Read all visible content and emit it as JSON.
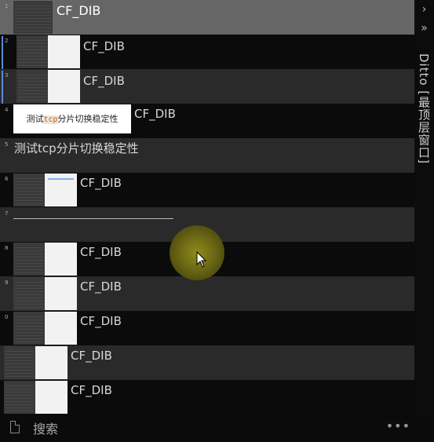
{
  "app": {
    "title": "Ditto [最顶层窗口]"
  },
  "sidebar": {
    "chevron_top": "›",
    "chevron_double": "»"
  },
  "rows": [
    {
      "num": "1",
      "label": "CF_DIB",
      "kind": "image"
    },
    {
      "num": "2",
      "label": "CF_DIB",
      "kind": "image"
    },
    {
      "num": "3",
      "label": "CF_DIB",
      "kind": "image"
    },
    {
      "num": "4",
      "label": "CF_DIB",
      "kind": "text-image",
      "card_prefix": "测试",
      "card_code": "tcp",
      "card_suffix": "分片切换稳定性"
    },
    {
      "num": "5",
      "label": "测试tcp分片切换稳定性",
      "kind": "text"
    },
    {
      "num": "6",
      "label": "CF_DIB",
      "kind": "image"
    },
    {
      "num": "7",
      "label": "",
      "kind": "line"
    },
    {
      "num": "8",
      "label": "CF_DIB",
      "kind": "image"
    },
    {
      "num": "9",
      "label": "CF_DIB",
      "kind": "image"
    },
    {
      "num": "0",
      "label": "CF_DIB",
      "kind": "image"
    },
    {
      "num": "",
      "label": "CF_DIB",
      "kind": "image"
    },
    {
      "num": "",
      "label": "CF_DIB",
      "kind": "image"
    }
  ],
  "footer": {
    "search_placeholder": "搜索",
    "more": "•••"
  }
}
